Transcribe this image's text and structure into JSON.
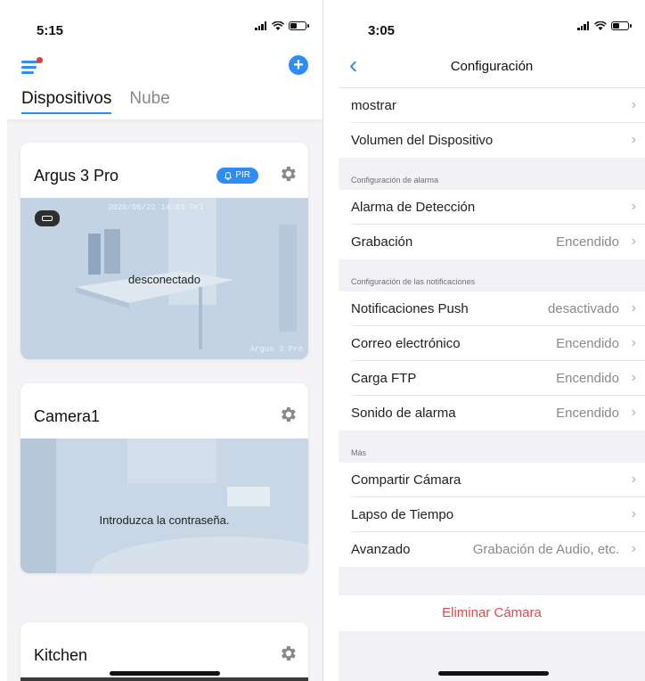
{
  "left": {
    "status": {
      "time": "5:15"
    },
    "header": {
      "tabs": [
        {
          "label": "Dispositivos",
          "active": true
        },
        {
          "label": "Nube",
          "active": false
        }
      ]
    },
    "cameras": [
      {
        "name": "Argus 3 Pro",
        "badge": "PIR",
        "message": "desconectado",
        "timestamp": "2020/06/22 14:03 Fri",
        "watermark": "Argus 3 Pro"
      },
      {
        "name": "Camera1",
        "message": "Introduzca la contraseña."
      },
      {
        "name": "Kitchen"
      }
    ]
  },
  "right": {
    "status": {
      "time": "3:05"
    },
    "nav": {
      "title": "Configuración",
      "back_icon": "chevron-left-icon"
    },
    "rows_top": [
      {
        "label": "mostrar",
        "value": ""
      },
      {
        "label": "Volumen del Dispositivo",
        "value": ""
      }
    ],
    "sections": [
      {
        "title": "Configuración de alarma",
        "rows": [
          {
            "label": "Alarma de Detección",
            "value": ""
          },
          {
            "label": "Grabación",
            "value": "Encendido"
          }
        ]
      },
      {
        "title": "Configuración de las notificaciones",
        "rows": [
          {
            "label": "Notificaciones Push",
            "value": "desactivado"
          },
          {
            "label": "Correo electrónico",
            "value": "Encendido"
          },
          {
            "label": "Carga FTP",
            "value": "Encendido"
          },
          {
            "label": "Sonido de alarma",
            "value": "Encendido"
          }
        ]
      },
      {
        "title": "Más",
        "rows": [
          {
            "label": "Compartir Cámara",
            "value": ""
          },
          {
            "label": "Lapso de Tiempo",
            "value": ""
          },
          {
            "label": "Avanzado",
            "value": "Grabación de Audio, etc."
          }
        ]
      }
    ],
    "delete_label": "Eliminar Cámara",
    "chevron": "›"
  },
  "colors": {
    "accent": "#2f8cf4",
    "danger": "#e0484c",
    "notify_dot": "#e53935"
  }
}
